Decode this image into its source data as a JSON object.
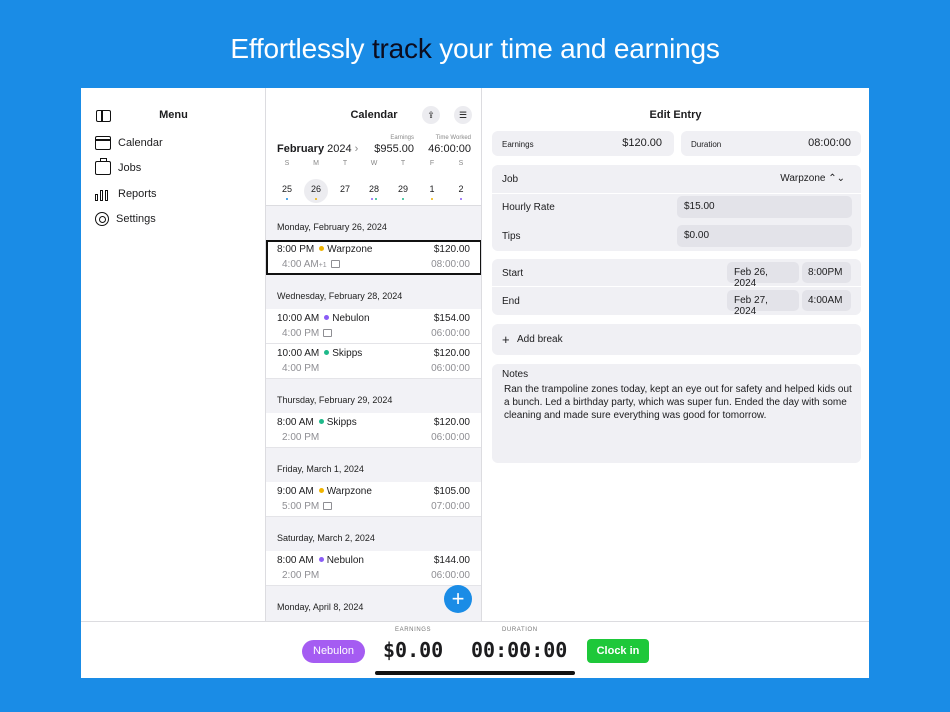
{
  "headline": {
    "before": "Effortlessly ",
    "highlight": "track",
    "after": " your time and earnings"
  },
  "menu": {
    "title": "Menu",
    "items": [
      {
        "label": "Calendar",
        "icon": "calendar-icon"
      },
      {
        "label": "Jobs",
        "icon": "briefcase-icon"
      },
      {
        "label": "Reports",
        "icon": "bar-chart-icon"
      },
      {
        "label": "Settings",
        "icon": "gear-icon"
      }
    ]
  },
  "calendar": {
    "title": "Calendar",
    "month": "February",
    "year": "2024",
    "chevron": "›",
    "earnings_label": "Earnings",
    "earnings_value": "$955.00",
    "time_label": "Time Worked",
    "time_value": "46:00:00",
    "weekdays": [
      "S",
      "M",
      "T",
      "W",
      "T",
      "F",
      "S"
    ],
    "days": [
      {
        "num": "25",
        "dots": [
          "#1a8ce6"
        ]
      },
      {
        "num": "26",
        "dots": [
          "#f0b400"
        ],
        "selected": true
      },
      {
        "num": "27",
        "dots": []
      },
      {
        "num": "28",
        "dots": [
          "#8a5cf6",
          "#1fb98a"
        ]
      },
      {
        "num": "29",
        "dots": [
          "#1fb98a"
        ]
      },
      {
        "num": "1",
        "dots": [
          "#f0b400"
        ]
      },
      {
        "num": "2",
        "dots": [
          "#8a5cf6"
        ]
      }
    ],
    "sections": [
      {
        "date": "Monday, February 26, 2024",
        "entries": [
          {
            "start": "8:00 PM",
            "job": "Warpzone",
            "color": "#f0b400",
            "amount": "$120.00",
            "end": "4:00 AM",
            "end_extra": "+1",
            "duration": "08:00:00",
            "icon": "note",
            "selected": true
          }
        ]
      },
      {
        "date": "Wednesday, February 28, 2024",
        "entries": [
          {
            "start": "10:00 AM",
            "job": "Nebulon",
            "color": "#8a5cf6",
            "amount": "$154.00",
            "end": "4:00 PM",
            "end_extra": "",
            "duration": "06:00:00",
            "icon": "note"
          },
          {
            "start": "10:00 AM",
            "job": "Skipps",
            "color": "#1fb98a",
            "amount": "$120.00",
            "end": "4:00 PM",
            "end_extra": "",
            "duration": "06:00:00",
            "icon": ""
          }
        ]
      },
      {
        "date": "Thursday, February 29, 2024",
        "entries": [
          {
            "start": "8:00 AM",
            "job": "Skipps",
            "color": "#1fb98a",
            "amount": "$120.00",
            "end": "2:00 PM",
            "end_extra": "",
            "duration": "06:00:00",
            "icon": ""
          }
        ]
      },
      {
        "date": "Friday, March 1, 2024",
        "entries": [
          {
            "start": "9:00 AM",
            "job": "Warpzone",
            "color": "#f0b400",
            "amount": "$105.00",
            "end": "5:00 PM",
            "end_extra": "",
            "duration": "07:00:00",
            "icon": "cup"
          }
        ]
      },
      {
        "date": "Saturday, March 2, 2024",
        "entries": [
          {
            "start": "8:00 AM",
            "job": "Nebulon",
            "color": "#8a5cf6",
            "amount": "$144.00",
            "end": "2:00 PM",
            "end_extra": "",
            "duration": "06:00:00",
            "icon": ""
          }
        ]
      },
      {
        "date": "Monday, April 8, 2024",
        "entries": []
      }
    ]
  },
  "edit": {
    "title": "Edit Entry",
    "earnings_label": "Earnings",
    "earnings_value": "$120.00",
    "duration_label": "Duration",
    "duration_value": "08:00:00",
    "job_label": "Job",
    "job_value": "Warpzone ⌃⌄",
    "rate_label": "Hourly Rate",
    "rate_value": "$15.00",
    "tips_label": "Tips",
    "tips_value": "$0.00",
    "start_label": "Start",
    "start_date": "Feb 26, 2024",
    "start_time": "8:00PM",
    "end_label": "End",
    "end_date": "Feb 27, 2024",
    "end_time": "4:00AM",
    "add_break": "Add break",
    "notes_label": "Notes",
    "notes_text": "Ran the trampoline zones today, kept an eye out for safety and helped kids out a bunch. Led a birthday party, which was super fun. Ended the day with some cleaning and made sure everything was good for tomorrow."
  },
  "bottom": {
    "job_pill": "Nebulon",
    "earnings_label": "EARNINGS",
    "earnings_value": "$0.00",
    "duration_label": "DURATION",
    "duration_value": "00:00:00",
    "clock_in": "Clock in"
  },
  "colors": {
    "background": "#1a8ce6",
    "accent": "#1a8ce6",
    "nebulon": "#a55cf2",
    "clock_in": "#1ec83a"
  }
}
